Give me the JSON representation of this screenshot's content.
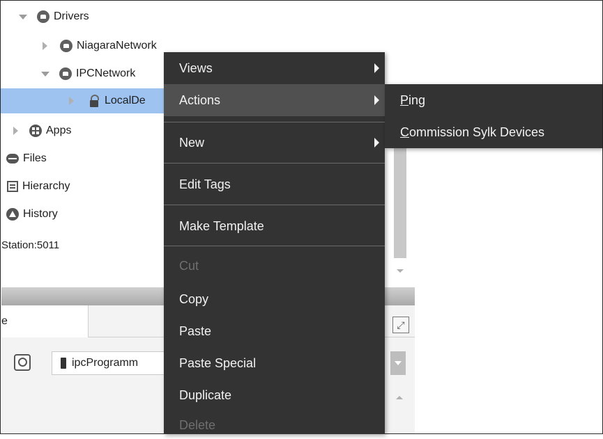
{
  "tree": {
    "items": [
      {
        "label": "Drivers",
        "icon": "drivers-icon",
        "expanded": true
      },
      {
        "label": "NiagaraNetwork",
        "icon": "network-icon",
        "expanded": false
      },
      {
        "label": "IPCNetwork",
        "icon": "network-icon",
        "expanded": true
      },
      {
        "label": "LocalDe",
        "icon": "device-icon",
        "expanded": false,
        "selected": true
      },
      {
        "label": "Apps",
        "icon": "apps-icon",
        "expanded": false
      },
      {
        "label": "Files",
        "icon": "files-icon"
      },
      {
        "label": "Hierarchy",
        "icon": "hierarchy-icon"
      },
      {
        "label": "History",
        "icon": "history-icon"
      }
    ],
    "station_label": "Station:5011"
  },
  "bottom_pane": {
    "tab_label": "e",
    "field_value": "ipcProgramm"
  },
  "context_menu": {
    "items": [
      {
        "label": "Views",
        "has_submenu": true
      },
      {
        "label": "Actions",
        "has_submenu": true,
        "highlighted": true
      },
      {
        "label": "New",
        "has_submenu": true
      },
      {
        "label": "Edit Tags"
      },
      {
        "label": "Make Template"
      },
      {
        "label": "Cut",
        "disabled": true
      },
      {
        "label": "Copy"
      },
      {
        "label": "Paste"
      },
      {
        "label": "Paste Special"
      },
      {
        "label": "Duplicate"
      },
      {
        "label": "Delete",
        "disabled": true
      }
    ]
  },
  "actions_submenu": {
    "items": [
      {
        "mnemonic": "P",
        "rest": "ing"
      },
      {
        "mnemonic": "C",
        "rest": "ommission Sylk Devices"
      }
    ]
  },
  "colors": {
    "menu_background": "#333333",
    "menu_highlight": "#505050",
    "tree_selection": "#9ec3f0"
  }
}
